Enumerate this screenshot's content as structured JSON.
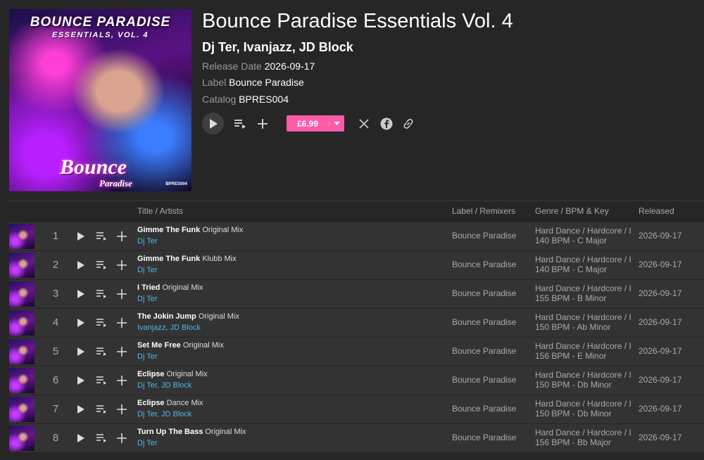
{
  "cover": {
    "line1": "BOUNCE PARADISE",
    "line2": "ESSENTIALS, VOL. 4",
    "logo1": "Bounce",
    "logo2": "Paradise",
    "catalog": "BPRES004"
  },
  "release": {
    "title": "Bounce Paradise Essentials Vol. 4",
    "artists": "Dj Ter, Ivanjazz, JD Block",
    "release_date_label": "Release Date",
    "release_date": "2026-09-17",
    "label_label": "Label",
    "label": "Bounce Paradise",
    "catalog_label": "Catalog",
    "catalog": "BPRES004",
    "price": "£6.99"
  },
  "icons": {
    "play": "play-icon",
    "queue": "add-to-queue-icon",
    "add": "plus-icon",
    "dropdown": "chevron-down-icon",
    "x": "x-logo-icon",
    "facebook": "facebook-icon",
    "link": "link-icon"
  },
  "colors": {
    "accent": "#ff5aa8",
    "artist_link": "#4fb6e0",
    "background": "#262626",
    "row": "#333333"
  },
  "tracklist": {
    "headers": {
      "title": "Title / Artists",
      "label": "Label / Remixers",
      "genre": "Genre / BPM & Key",
      "released": "Released"
    },
    "tracks": [
      {
        "num": "1",
        "title": "Gimme The Funk",
        "mix": "Original Mix",
        "artists": "Dj Ter",
        "label": "Bounce Paradise",
        "genre": "Hard Dance / Hardcore / I",
        "bpm_key": "140 BPM - C Major",
        "released": "2026-09-17"
      },
      {
        "num": "2",
        "title": "Gimme The Funk",
        "mix": "Klubb Mix",
        "artists": "Dj Ter",
        "label": "Bounce Paradise",
        "genre": "Hard Dance / Hardcore / I",
        "bpm_key": "140 BPM - C Major",
        "released": "2026-09-17"
      },
      {
        "num": "3",
        "title": "I Tried",
        "mix": "Original Mix",
        "artists": "Dj Ter",
        "label": "Bounce Paradise",
        "genre": "Hard Dance / Hardcore / I",
        "bpm_key": "155 BPM - B Minor",
        "released": "2026-09-17"
      },
      {
        "num": "4",
        "title": "The Jokin Jump",
        "mix": "Original Mix",
        "artists": "Ivanjazz, JD Block",
        "label": "Bounce Paradise",
        "genre": "Hard Dance / Hardcore / I",
        "bpm_key": "150 BPM - Ab Minor",
        "released": "2026-09-17"
      },
      {
        "num": "5",
        "title": "Set Me Free",
        "mix": "Original Mix",
        "artists": "Dj Ter",
        "label": "Bounce Paradise",
        "genre": "Hard Dance / Hardcore / I",
        "bpm_key": "156 BPM - E Minor",
        "released": "2026-09-17"
      },
      {
        "num": "6",
        "title": "Eclipse",
        "mix": "Original Mix",
        "artists": "Dj Ter, JD Block",
        "label": "Bounce Paradise",
        "genre": "Hard Dance / Hardcore / I",
        "bpm_key": "150 BPM - Db Minor",
        "released": "2026-09-17"
      },
      {
        "num": "7",
        "title": "Eclipse",
        "mix": "Dance Mix",
        "artists": "Dj Ter, JD Block",
        "label": "Bounce Paradise",
        "genre": "Hard Dance / Hardcore / I",
        "bpm_key": "150 BPM - Db Minor",
        "released": "2026-09-17"
      },
      {
        "num": "8",
        "title": "Turn Up The Bass",
        "mix": "Original Mix",
        "artists": "Dj Ter",
        "label": "Bounce Paradise",
        "genre": "Hard Dance / Hardcore / I",
        "bpm_key": "156 BPM - Bb Major",
        "released": "2026-09-17"
      }
    ]
  }
}
